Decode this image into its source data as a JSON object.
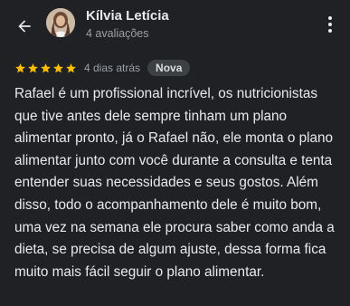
{
  "header": {
    "back_icon": "arrow-left-icon",
    "user_name": "Kílvia Letícia",
    "user_reviews": "4 avaliações",
    "menu_icon": "more-vert-icon"
  },
  "review": {
    "stars": 5,
    "star_color": "#fbbc04",
    "time": "4 dias atrás",
    "badge": "Nova",
    "text": "Rafael é um profissional incrível, os nutricionistas que tive antes dele sempre tinham um plano alimentar pronto, já o Rafael não, ele monta o plano alimentar junto com você durante a consulta e tenta entender suas necessidades e seus gostos. Além disso, todo o acompanhamento dele é muito bom, uma vez na semana ele procura saber como anda a dieta, se precisa de algum ajuste, dessa forma fica muito mais fácil seguir o plano alimentar."
  },
  "colors": {
    "background": "#202124",
    "primary_text": "#e8eaed",
    "secondary_text": "#9aa0a6",
    "badge_bg": "#3c4043"
  }
}
